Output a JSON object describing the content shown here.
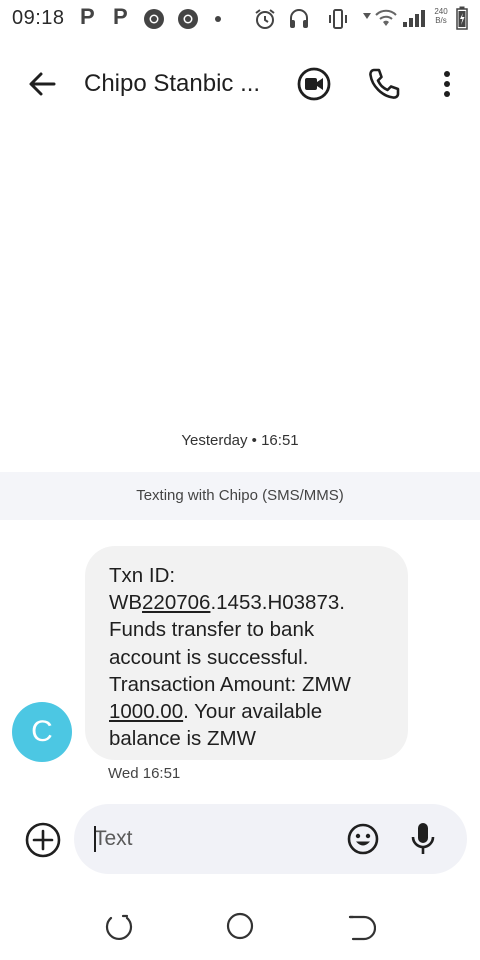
{
  "status_bar": {
    "time": "09:18",
    "icons": [
      "p-notification-icon",
      "p-notification-icon",
      "chrome-icon",
      "chrome-icon",
      "dot-icon",
      "alarm-icon",
      "headset-icon",
      "vibrate-icon",
      "wifi-icon",
      "signal-icon",
      "battery-icon"
    ],
    "net_speed_value": "240",
    "net_speed_unit": "B/s"
  },
  "app_bar": {
    "title": "Chipo Stanbic ..."
  },
  "conversation": {
    "timestamp": "Yesterday • 16:51",
    "banner": "Texting with Chipo (SMS/MMS)",
    "message": {
      "line1": "Txn ID:",
      "line2_prefix": "WB",
      "line2_link": "220706",
      "line2_suffix": ".1453.H03873.",
      "line3": "Funds transfer to bank",
      "line4": "account is successful.",
      "line5": "Transaction Amount: ZMW",
      "line6_link": "1000.00",
      "line6_suffix": ". Your available",
      "line7": "balance is ZMW"
    },
    "avatar_letter": "C",
    "message_time": "Wed 16:51"
  },
  "compose": {
    "placeholder": "Text"
  },
  "colors": {
    "avatar": "#4cc7e3",
    "bubble": "#f2f2f2",
    "compose_bg": "#f1f2f7",
    "banner_bg": "#f4f5f9"
  }
}
